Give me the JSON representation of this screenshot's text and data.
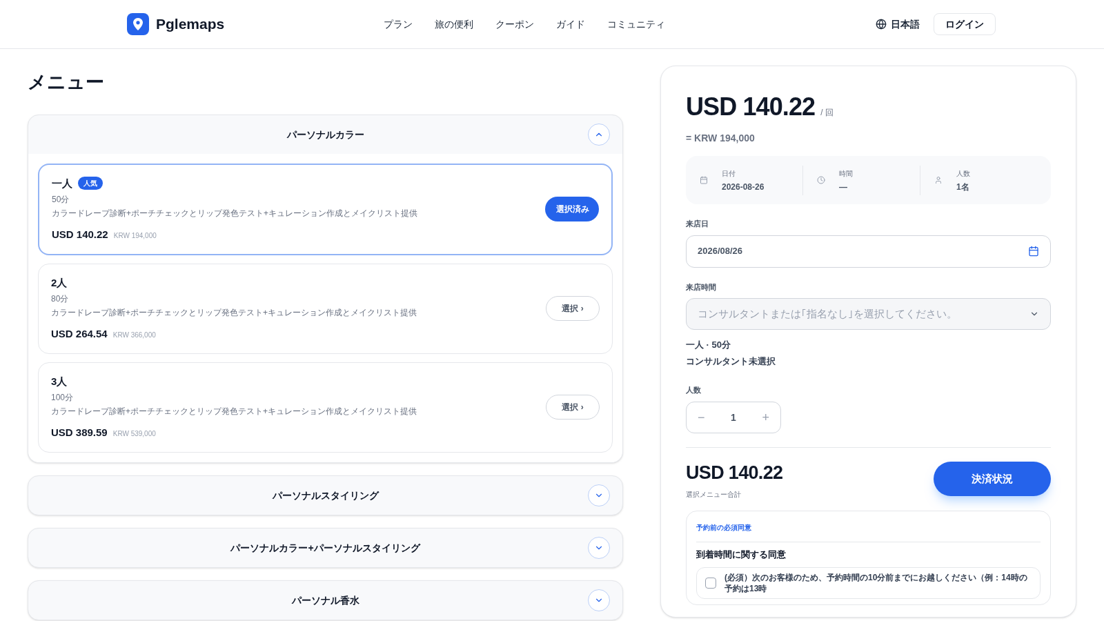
{
  "header": {
    "brand": "Pglemaps",
    "nav": [
      "プラン",
      "旅の便利",
      "クーポン",
      "ガイド",
      "コミュニティ"
    ],
    "language": "日本語",
    "login": "ログイン"
  },
  "menu": {
    "title": "メニュー",
    "groups": [
      {
        "title": "パーソナルカラー",
        "expanded": true,
        "options": [
          {
            "name": "一人",
            "badge": "人気",
            "duration": "50分",
            "description": "カラードレープ診断+ポーチチェックとリップ発色テスト+キュレーション作成とメイクリスト提供",
            "price": "USD 140.22",
            "price_krw": "KRW 194,000",
            "selected": true,
            "button": "選択済み"
          },
          {
            "name": "2人",
            "duration": "80分",
            "description": "カラードレープ診断+ポーチチェックとリップ発色テスト+キュレーション作成とメイクリスト提供",
            "price": "USD 264.54",
            "price_krw": "KRW 366,000",
            "selected": false,
            "button": "選択 ›"
          },
          {
            "name": "3人",
            "duration": "100分",
            "description": "カラードレープ診断+ポーチチェックとリップ発色テスト+キュレーション作成とメイクリスト提供",
            "price": "USD 389.59",
            "price_krw": "KRW 539,000",
            "selected": false,
            "button": "選択 ›"
          }
        ]
      },
      {
        "title": "パーソナルスタイリング",
        "expanded": false
      },
      {
        "title": "パーソナルカラー+パーソナルスタイリング",
        "expanded": false
      },
      {
        "title": "パーソナル香水",
        "expanded": false
      }
    ]
  },
  "booking": {
    "price": "USD 140.22",
    "per": "/ 回",
    "price_krw": "= KRW 194,000",
    "summary": [
      {
        "kind": "date",
        "label": "日付",
        "value": "2026-08-26"
      },
      {
        "kind": "time",
        "label": "時間",
        "value": "—"
      },
      {
        "kind": "people",
        "label": "人数",
        "value": "1名"
      }
    ],
    "date_label": "来店日",
    "date_value": "2026/08/26",
    "time_label": "来店時間",
    "time_placeholder": "コンサルタントまたは｢指名なし｣を選択してください。",
    "selection_line": "一人 · 50分",
    "consultant_line": "コンサルタント未選択",
    "people_label": "人数",
    "people_value": "1",
    "minus": "−",
    "plus": "+",
    "total": "USD 140.22",
    "total_label": "選択メニュー合計",
    "pay_button": "決済状況",
    "consent": {
      "title": "予約前の必須同意",
      "heading": "到着時間に関する同意",
      "items": [
        {
          "text": "(必須）次のお客様のため、予約時間の10分前までにお越しください（例：14時の予約は13時",
          "checked": false
        }
      ]
    }
  }
}
